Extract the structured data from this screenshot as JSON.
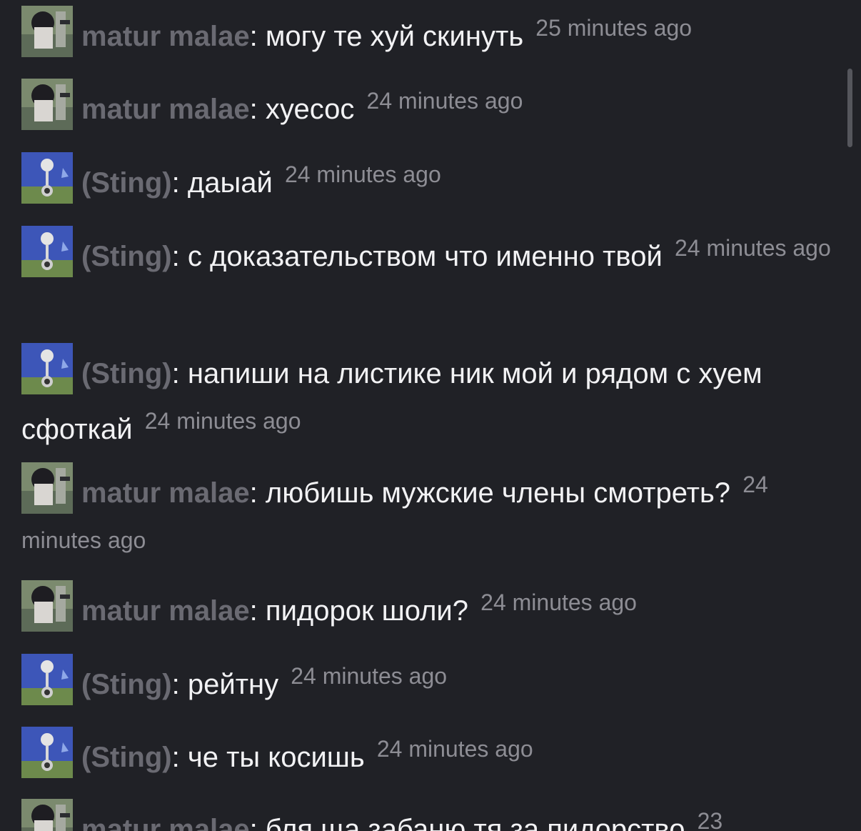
{
  "colors": {
    "background": "#202126",
    "username": "#6a6a72",
    "text": "#f2f2f4",
    "timestamp": "#8d8d94"
  },
  "messages": [
    {
      "user": "matur malae",
      "avatar": "photo-avatar",
      "separator": ":",
      "text": "могу те хуй скинуть",
      "time": "25 minutes ago"
    },
    {
      "user": "matur malae",
      "avatar": "photo-avatar",
      "separator": ":",
      "text": "хуесос",
      "time": "24 minutes ago"
    },
    {
      "user": "(Sting)",
      "avatar": "sting-avatar",
      "separator": ":",
      "text": "даыай",
      "time": "24 minutes ago"
    },
    {
      "user": "(Sting)",
      "avatar": "sting-avatar",
      "separator": ":",
      "text": "с доказательством что именно твой",
      "time": "24 minutes ago"
    },
    {
      "user": "(Sting)",
      "avatar": "sting-avatar",
      "separator": ":",
      "text": "напиши на листике ник мой и рядом с хуем сфоткай",
      "time": "24 minutes ago"
    },
    {
      "user": "matur malae",
      "avatar": "photo-avatar",
      "separator": ":",
      "text": "любишь мужские члены смотреть?",
      "time": "24 minutes ago"
    },
    {
      "user": "matur malae",
      "avatar": "photo-avatar",
      "separator": ":",
      "text": "пидорок шоли?",
      "time": "24 minutes ago"
    },
    {
      "user": "(Sting)",
      "avatar": "sting-avatar",
      "separator": ":",
      "text": "рейтну",
      "time": "24 minutes ago"
    },
    {
      "user": "(Sting)",
      "avatar": "sting-avatar",
      "separator": ":",
      "text": "че ты косишь",
      "time": "24 minutes ago"
    },
    {
      "user": "matur malae",
      "avatar": "photo-avatar",
      "separator": ":",
      "text": "бля ща забаню тя за пидорство",
      "time": "23"
    }
  ]
}
